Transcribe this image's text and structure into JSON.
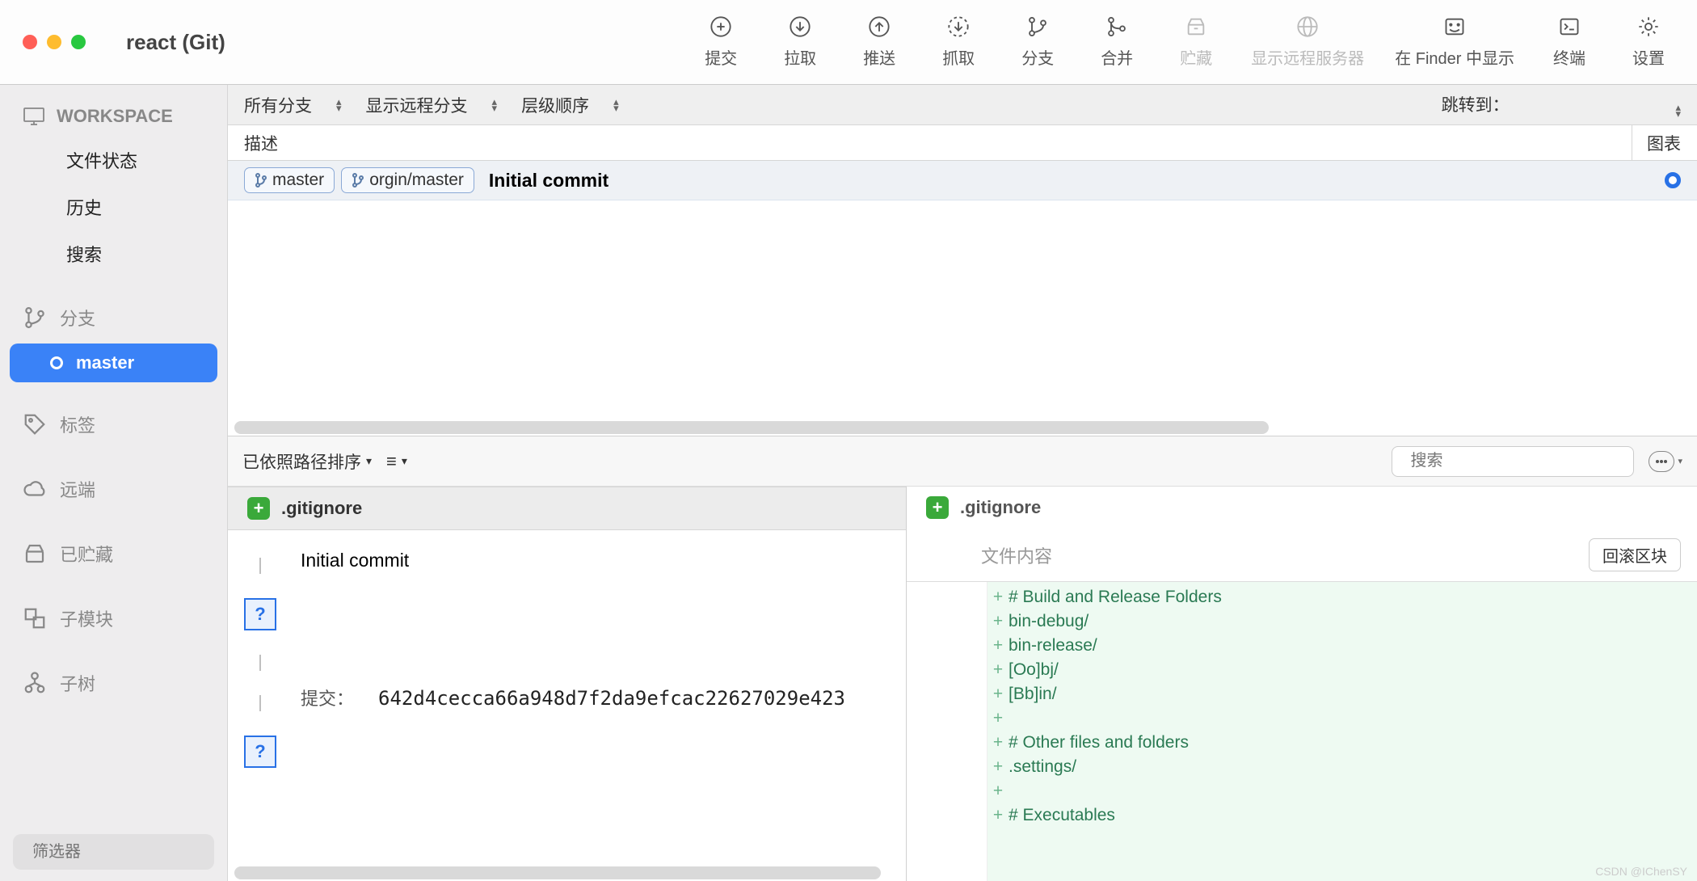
{
  "window": {
    "title": "react (Git)"
  },
  "toolbar": [
    {
      "id": "commit",
      "label": "提交",
      "icon": "plus-circle"
    },
    {
      "id": "pull",
      "label": "拉取",
      "icon": "down-circle"
    },
    {
      "id": "push",
      "label": "推送",
      "icon": "up-circle"
    },
    {
      "id": "fetch",
      "label": "抓取",
      "icon": "refresh-dashed"
    },
    {
      "id": "branch",
      "label": "分支",
      "icon": "branch"
    },
    {
      "id": "merge",
      "label": "合并",
      "icon": "merge"
    },
    {
      "id": "stash",
      "label": "贮藏",
      "icon": "stash",
      "disabled": true
    },
    {
      "id": "remote",
      "label": "显示远程服务器",
      "icon": "globe",
      "disabled": true
    },
    {
      "id": "finder",
      "label": "在 Finder 中显示",
      "icon": "finder"
    },
    {
      "id": "terminal",
      "label": "终端",
      "icon": "terminal"
    },
    {
      "id": "settings",
      "label": "设置",
      "icon": "gear"
    }
  ],
  "sidebar": {
    "workspace_label": "WORKSPACE",
    "items": [
      "文件状态",
      "历史",
      "搜索"
    ],
    "sections": {
      "branch": "分支",
      "active_branch": "master",
      "tags": "标签",
      "remotes": "远端",
      "stashes": "已贮藏",
      "submodules": "子模块",
      "subtrees": "子树"
    },
    "filter_placeholder": "筛选器"
  },
  "filterbar": {
    "all_branches": "所有分支",
    "show_remote": "显示远程分支",
    "order": "层级顺序",
    "jump": "跳转到："
  },
  "columns": {
    "description": "描述",
    "chart": "图表"
  },
  "commit_row": {
    "tags": [
      "master",
      "orgin/master"
    ],
    "message": "Initial commit"
  },
  "detail": {
    "sort": "已依照路径排序",
    "search_placeholder": "搜索",
    "file": ".gitignore",
    "commit_message": "Initial commit",
    "hash_label": "提交：",
    "hash": "642d4cecca66a948d7f2da9efcac22627029e423",
    "file_content_label": "文件内容",
    "rollback": "回滚区块",
    "diff_lines": [
      "# Build and Release Folders",
      "bin-debug/",
      "bin-release/",
      "[Oo]bj/",
      "[Bb]in/",
      "",
      "# Other files and folders",
      ".settings/",
      "",
      "# Executables"
    ]
  },
  "watermark": "CSDN @IChenSY"
}
